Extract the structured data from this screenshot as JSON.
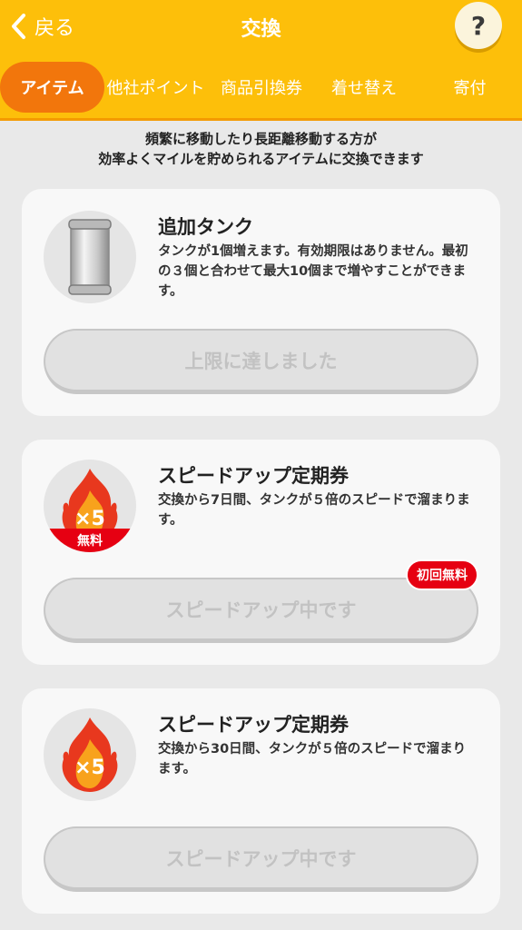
{
  "header": {
    "back_label": "戻る",
    "title": "交換",
    "help_label": "?"
  },
  "tabs": [
    {
      "label": "アイテム",
      "active": true
    },
    {
      "label": "他社ポイント",
      "active": false
    },
    {
      "label": "商品引換券",
      "active": false
    },
    {
      "label": "着せ替え",
      "active": false
    },
    {
      "label": "寄付",
      "active": false
    }
  ],
  "intro": {
    "line1": "頻繁に移動したり長距離移動する方が",
    "line2": "効率よくマイルを貯められるアイテムに交換できます"
  },
  "items": [
    {
      "name": "追加タンク",
      "description": "タンクが1個増えます。有効期限はありません。最初の３個と合わせて最大10個まで増やすことができます。",
      "button_label": "上限に達しました",
      "icon": "tank-icon"
    },
    {
      "name": "スピードアップ定期券",
      "description": "交換から7日間、タンクが５倍のスピードで溜まります。",
      "button_label": "スピードアップ中です",
      "badge": "初回無料",
      "icon_text": "×5",
      "free_label": "無料",
      "icon": "flame-icon"
    },
    {
      "name": "スピードアップ定期券",
      "description": "交換から30日間、タンクが５倍のスピードで溜まります。",
      "button_label": "スピードアップ中です",
      "icon_text": "×5",
      "icon": "flame-icon"
    }
  ],
  "colors": {
    "header_bg": "#fdbf0a",
    "active_tab": "#f2760c",
    "badge_red": "#e60012",
    "page_bg": "#e9e9e9"
  }
}
